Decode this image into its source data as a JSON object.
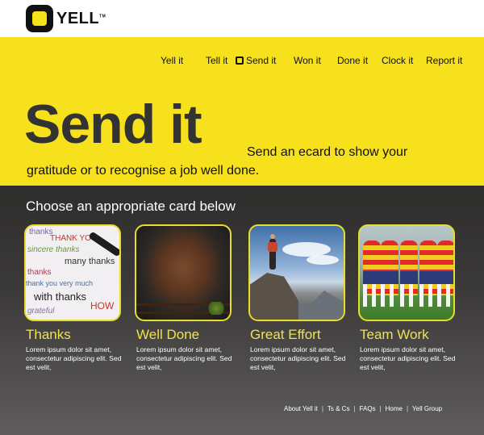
{
  "brand": {
    "name": "YELL",
    "tm": "TM"
  },
  "nav": {
    "items": [
      {
        "label": "Yell it"
      },
      {
        "label": "Tell it"
      },
      {
        "label": "Send it",
        "active": true
      },
      {
        "label": "Won it"
      },
      {
        "label": "Done it"
      },
      {
        "label": "Clock it"
      },
      {
        "label": "Report it"
      }
    ]
  },
  "hero": {
    "title": "Send it",
    "tagline_line1": "Send an ecard to show your",
    "tagline_line2": "gratitude or to recognise a job well done."
  },
  "main": {
    "heading": "Choose an appropriate card below",
    "cards": [
      {
        "title": "Thanks",
        "description": "Lorem ipsum dolor sit amet, consectetur adipiscing elit. Sed est velit,",
        "image": "thanks-words-photo"
      },
      {
        "title": "Well Done",
        "description": "Lorem ipsum dolor sit amet, consectetur adipiscing elit. Sed est velit,",
        "image": "steak-photo"
      },
      {
        "title": "Great Effort",
        "description": "Lorem ipsum dolor sit amet, consectetur adipiscing elit. Sed est velit,",
        "image": "mountain-climber-photo"
      },
      {
        "title": "Team Work",
        "description": "Lorem ipsum dolor sit amet, consectetur adipiscing elit. Sed est velit,",
        "image": "rugby-team-huddle-photo"
      }
    ]
  },
  "thanks_words": [
    "thanks",
    "THANK YOU",
    "many thanks",
    "with thanks",
    "thank you very much",
    "HOW",
    "grateful",
    "sincere thanks",
    "thanks"
  ],
  "footer": {
    "links": [
      "About Yell it",
      "Ts & Cs",
      "FAQs",
      "Home",
      "Yell Group"
    ],
    "separator": "|"
  },
  "colors": {
    "brand_yellow": "#f7e11d",
    "card_title": "#f0e24a",
    "card_border": "#e8de2a"
  }
}
